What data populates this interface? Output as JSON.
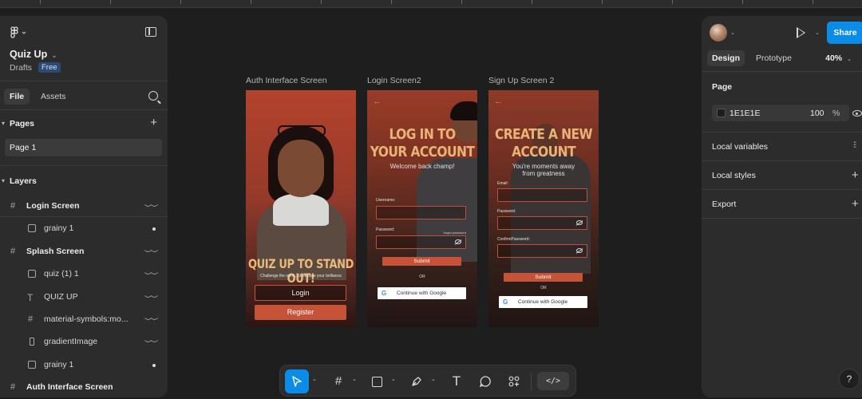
{
  "file": {
    "name": "Quiz Up",
    "location": "Drafts",
    "plan_badge": "Free"
  },
  "left_tabs": {
    "file": "File",
    "assets": "Assets"
  },
  "pages": {
    "heading": "Pages",
    "items": [
      {
        "label": "Page 1"
      }
    ]
  },
  "layers": {
    "heading": "Layers",
    "items": [
      {
        "label": "Login Screen",
        "kind": "frame",
        "indent": 0
      },
      {
        "label": "grainy 1",
        "kind": "image",
        "indent": 1
      },
      {
        "label": "Splash Screen",
        "kind": "frame",
        "indent": 0
      },
      {
        "label": "quiz (1) 1",
        "kind": "image",
        "indent": 1
      },
      {
        "label": "QUIZ UP",
        "kind": "text",
        "indent": 1
      },
      {
        "label": "material-symbols:mo...",
        "kind": "frame",
        "indent": 1
      },
      {
        "label": "gradientImage",
        "kind": "rect",
        "indent": 1
      },
      {
        "label": "grainy 1",
        "kind": "image",
        "indent": 1
      },
      {
        "label": "Auth Interface Screen",
        "kind": "frame",
        "indent": 0
      }
    ]
  },
  "frames": {
    "auth": {
      "label": "Auth Interface Screen",
      "title": "QUIZ UP TO STAND OUT!",
      "subtitle": "Challenge the norm. Showcase your brilliance",
      "login": "Login",
      "register": "Register"
    },
    "login": {
      "label": "Login Screen2",
      "back": "←",
      "title_line1": "LOG IN TO",
      "title_line2": "YOUR ACCOUNT",
      "subtitle": "Welcome back champ!",
      "username_label": "Username:",
      "password_label": "Password:",
      "forgot": "forgot password",
      "submit": "Submit",
      "or": "OR",
      "google": "Continue with Google"
    },
    "signup": {
      "label": "Sign Up Screen 2",
      "back": "←",
      "title_line1": "CREATE A NEW",
      "title_line2": "ACCOUNT",
      "subtitle_line1": "You're moments away",
      "subtitle_line2": "from greatness",
      "email_label": "Email:",
      "password_label": "Password:",
      "confirm_label": "ConfirmPassword:",
      "submit": "Submit",
      "or": "OR",
      "google": "Continue with Google"
    }
  },
  "right_panel": {
    "tabs": {
      "design": "Design",
      "prototype": "Prototype"
    },
    "zoom": "40%",
    "share": "Share",
    "page_section": {
      "title": "Page",
      "color_hex": "1E1E1E",
      "opacity": "100",
      "percent": "%"
    },
    "local_variables": "Local variables",
    "local_styles": "Local styles",
    "export": "Export"
  },
  "help": "?",
  "colors": {
    "accent": "#0c8ce9",
    "canvas": "#1e1e1e",
    "panel": "#2c2c2c",
    "brand_orange": "#c65237",
    "title_gold": "#e8b377"
  },
  "icons": {
    "move_tool": "arrow-pointer-icon",
    "frame_tool": "hash-icon",
    "shape_tool": "square-icon",
    "pen_tool": "pen-icon",
    "text_tool": "text-icon",
    "comment_tool": "comment-icon",
    "actions": "apps-icon",
    "dev_mode": "code-icon"
  }
}
